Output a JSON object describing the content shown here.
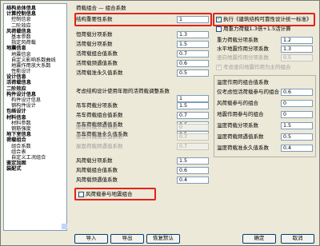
{
  "tree": [
    {
      "label": "结构总体信息",
      "level": 0
    },
    {
      "label": "计算控制信息",
      "level": 0
    },
    {
      "label": "控制信息",
      "level": 1
    },
    {
      "label": "二阶效应",
      "level": 1
    },
    {
      "label": "风荷载信息",
      "level": 0
    },
    {
      "label": "基本参数",
      "level": 1
    },
    {
      "label": "指定风荷载",
      "level": 1
    },
    {
      "label": "地震信息",
      "level": 0
    },
    {
      "label": "地震信息",
      "level": 1
    },
    {
      "label": "自定义影响系数曲线",
      "level": 1
    },
    {
      "label": "地震作用放大系数",
      "level": 1
    },
    {
      "label": "性能设计",
      "level": 1
    },
    {
      "label": "设计信息",
      "level": 0
    },
    {
      "label": "活荷载信息",
      "level": 0
    },
    {
      "label": "二阶效应",
      "level": 0
    },
    {
      "label": "构件设计信息",
      "level": 0
    },
    {
      "label": "构件设计信息",
      "level": 1
    },
    {
      "label": "钢构件设计",
      "level": 1
    },
    {
      "label": "包络设计",
      "level": 0
    },
    {
      "label": "材料信息",
      "level": 0
    },
    {
      "label": "材料参数",
      "level": 1
    },
    {
      "label": "钢筋强度",
      "level": 1
    },
    {
      "label": "地下室信息",
      "level": 0
    },
    {
      "label": "荷载组合",
      "level": 0
    },
    {
      "label": "组合系数",
      "level": 1
    },
    {
      "label": "组合表",
      "level": 1
    },
    {
      "label": "自定义工况组合",
      "level": 1
    },
    {
      "label": "鉴定加固",
      "level": 0
    },
    {
      "label": "装配式",
      "level": 0
    }
  ],
  "tab_title": "荷载组合 — 组合系数",
  "left": {
    "importance": {
      "label": "结构重要性系数",
      "value": "1"
    },
    "rows1": [
      {
        "label": "恒荷载分项系数",
        "value": "1.3"
      },
      {
        "label": "活荷载分项系数",
        "value": "1.5"
      },
      {
        "label": "活荷载组合值系数",
        "value": "0.7"
      },
      {
        "label": "活荷载频遇值系数",
        "value": "0.6"
      },
      {
        "label": "活荷载准永久值系数",
        "value": "0.5"
      }
    ],
    "design_life": {
      "label": "考虑结构设计使用年限的活荷载调整系数",
      "value": "1"
    },
    "rows2": [
      {
        "label": "吊车荷载分项系数",
        "value": "1.5"
      },
      {
        "label": "吊车荷载组合值系数",
        "value": "0.7"
      },
      {
        "label": "吊车荷载频遇值系数",
        "value": "0.6"
      },
      {
        "label": "吊车荷载准永久值系数",
        "value": "0.5"
      }
    ],
    "rows2_disabled": [
      {
        "label": "屋面荷载分项系数",
        "value": "0"
      },
      {
        "label": "屋面荷载组合值系数",
        "value": "0.7"
      },
      {
        "label": "屋面荷载频遇值系数",
        "value": "0.7"
      }
    ],
    "rows3": [
      {
        "label": "风荷载分项系数",
        "value": "1.5"
      },
      {
        "label": "风荷载组合值系数",
        "value": "0.6"
      },
      {
        "label": "风荷载频遇值系数",
        "value": "0.4"
      }
    ],
    "wind_quake": {
      "label": "风荷载参与地震组合"
    }
  },
  "right": {
    "exec_code": {
      "label": "执行《建筑结构可靠性设计统一标准》"
    },
    "special": {
      "label": "用重力荷载1.3倍+1.5活计算"
    },
    "rows1": [
      {
        "label": "重力荷载分项系数",
        "value": "1.2"
      },
      {
        "label": "水平地震作用分项系数",
        "value": "1.3"
      },
      {
        "label": "竖向地震作用分项系数",
        "value": "0.5"
      }
    ],
    "vertical_main": {
      "label": "考虑竖向地震作用为主的组合"
    },
    "temp_header": "温度作用的组合值系数",
    "temp_rows": [
      {
        "label": "仅考虑恒活荷载参与的组合",
        "value": "0.6"
      },
      {
        "label": "风荷载参与的组合",
        "value": "0"
      },
      {
        "label": "地震作用参与的组合",
        "value": "0"
      },
      {
        "label": "温度荷载分项系数",
        "value": "1.5"
      },
      {
        "label": "温度荷载频遇值系数",
        "value": "0.5"
      },
      {
        "label": "温度荷载准永久值系数",
        "value": "0.4"
      }
    ]
  },
  "buttons": {
    "import": "导入",
    "export": "导出",
    "default": "恢复默认",
    "ok": "确定",
    "cancel": "取消"
  }
}
